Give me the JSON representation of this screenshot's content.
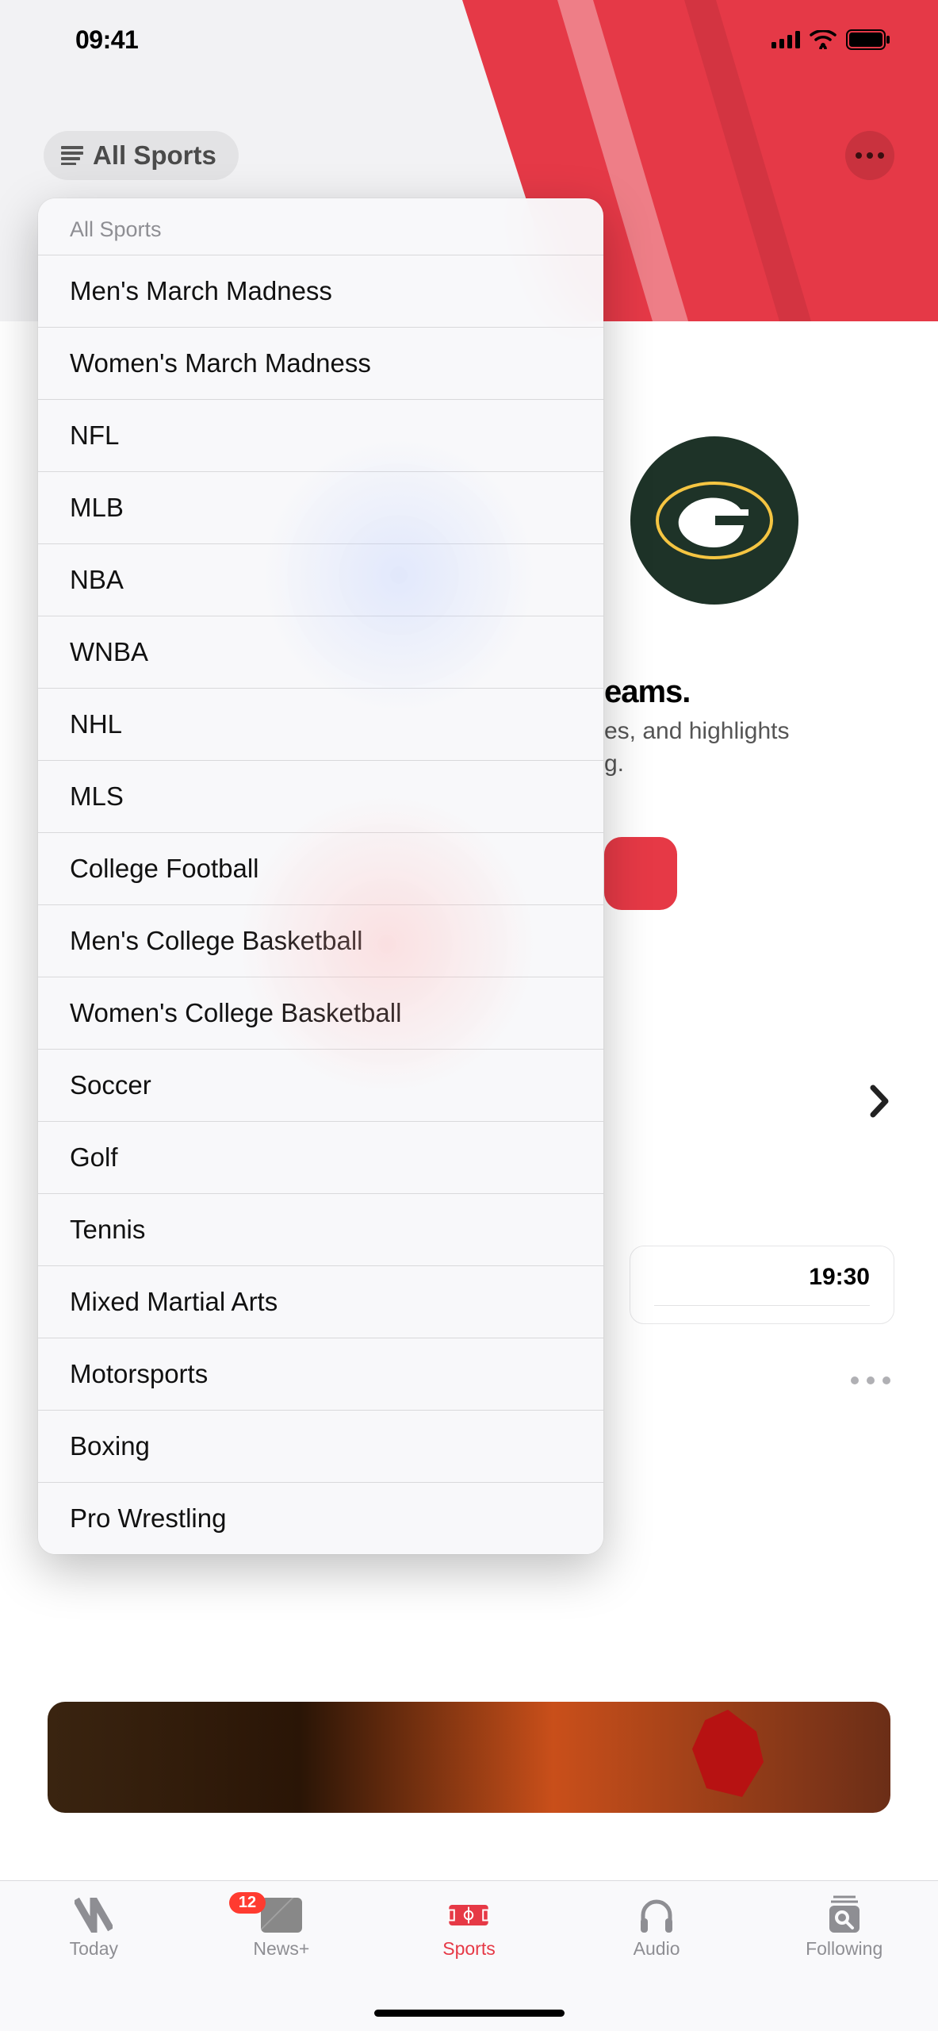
{
  "status": {
    "time": "09:41"
  },
  "header": {
    "allSportsLabel": "All Sports"
  },
  "dropdown": {
    "headerLabel": "All Sports",
    "items": [
      "Men's March Madness",
      "Women's March Madness",
      "NFL",
      "MLB",
      "NBA",
      "WNBA",
      "NHL",
      "MLS",
      "College Football",
      "Men's College Basketball",
      "Women's College Basketball",
      "Soccer",
      "Golf",
      "Tennis",
      "Mixed Martial Arts",
      "Motorsports",
      "Boxing",
      "Pro Wrestling"
    ]
  },
  "background": {
    "teamsTitlePartial": "eams.",
    "teamsSubPartial1": "es, and highlights",
    "teamsSubPartial2": "g.",
    "teamLogoInitial": "G",
    "scheduleTime": "19:30"
  },
  "tabs": {
    "today": "Today",
    "newsplus": "News+",
    "newsplusBadge": "12",
    "sports": "Sports",
    "audio": "Audio",
    "following": "Following",
    "active": "sports"
  }
}
